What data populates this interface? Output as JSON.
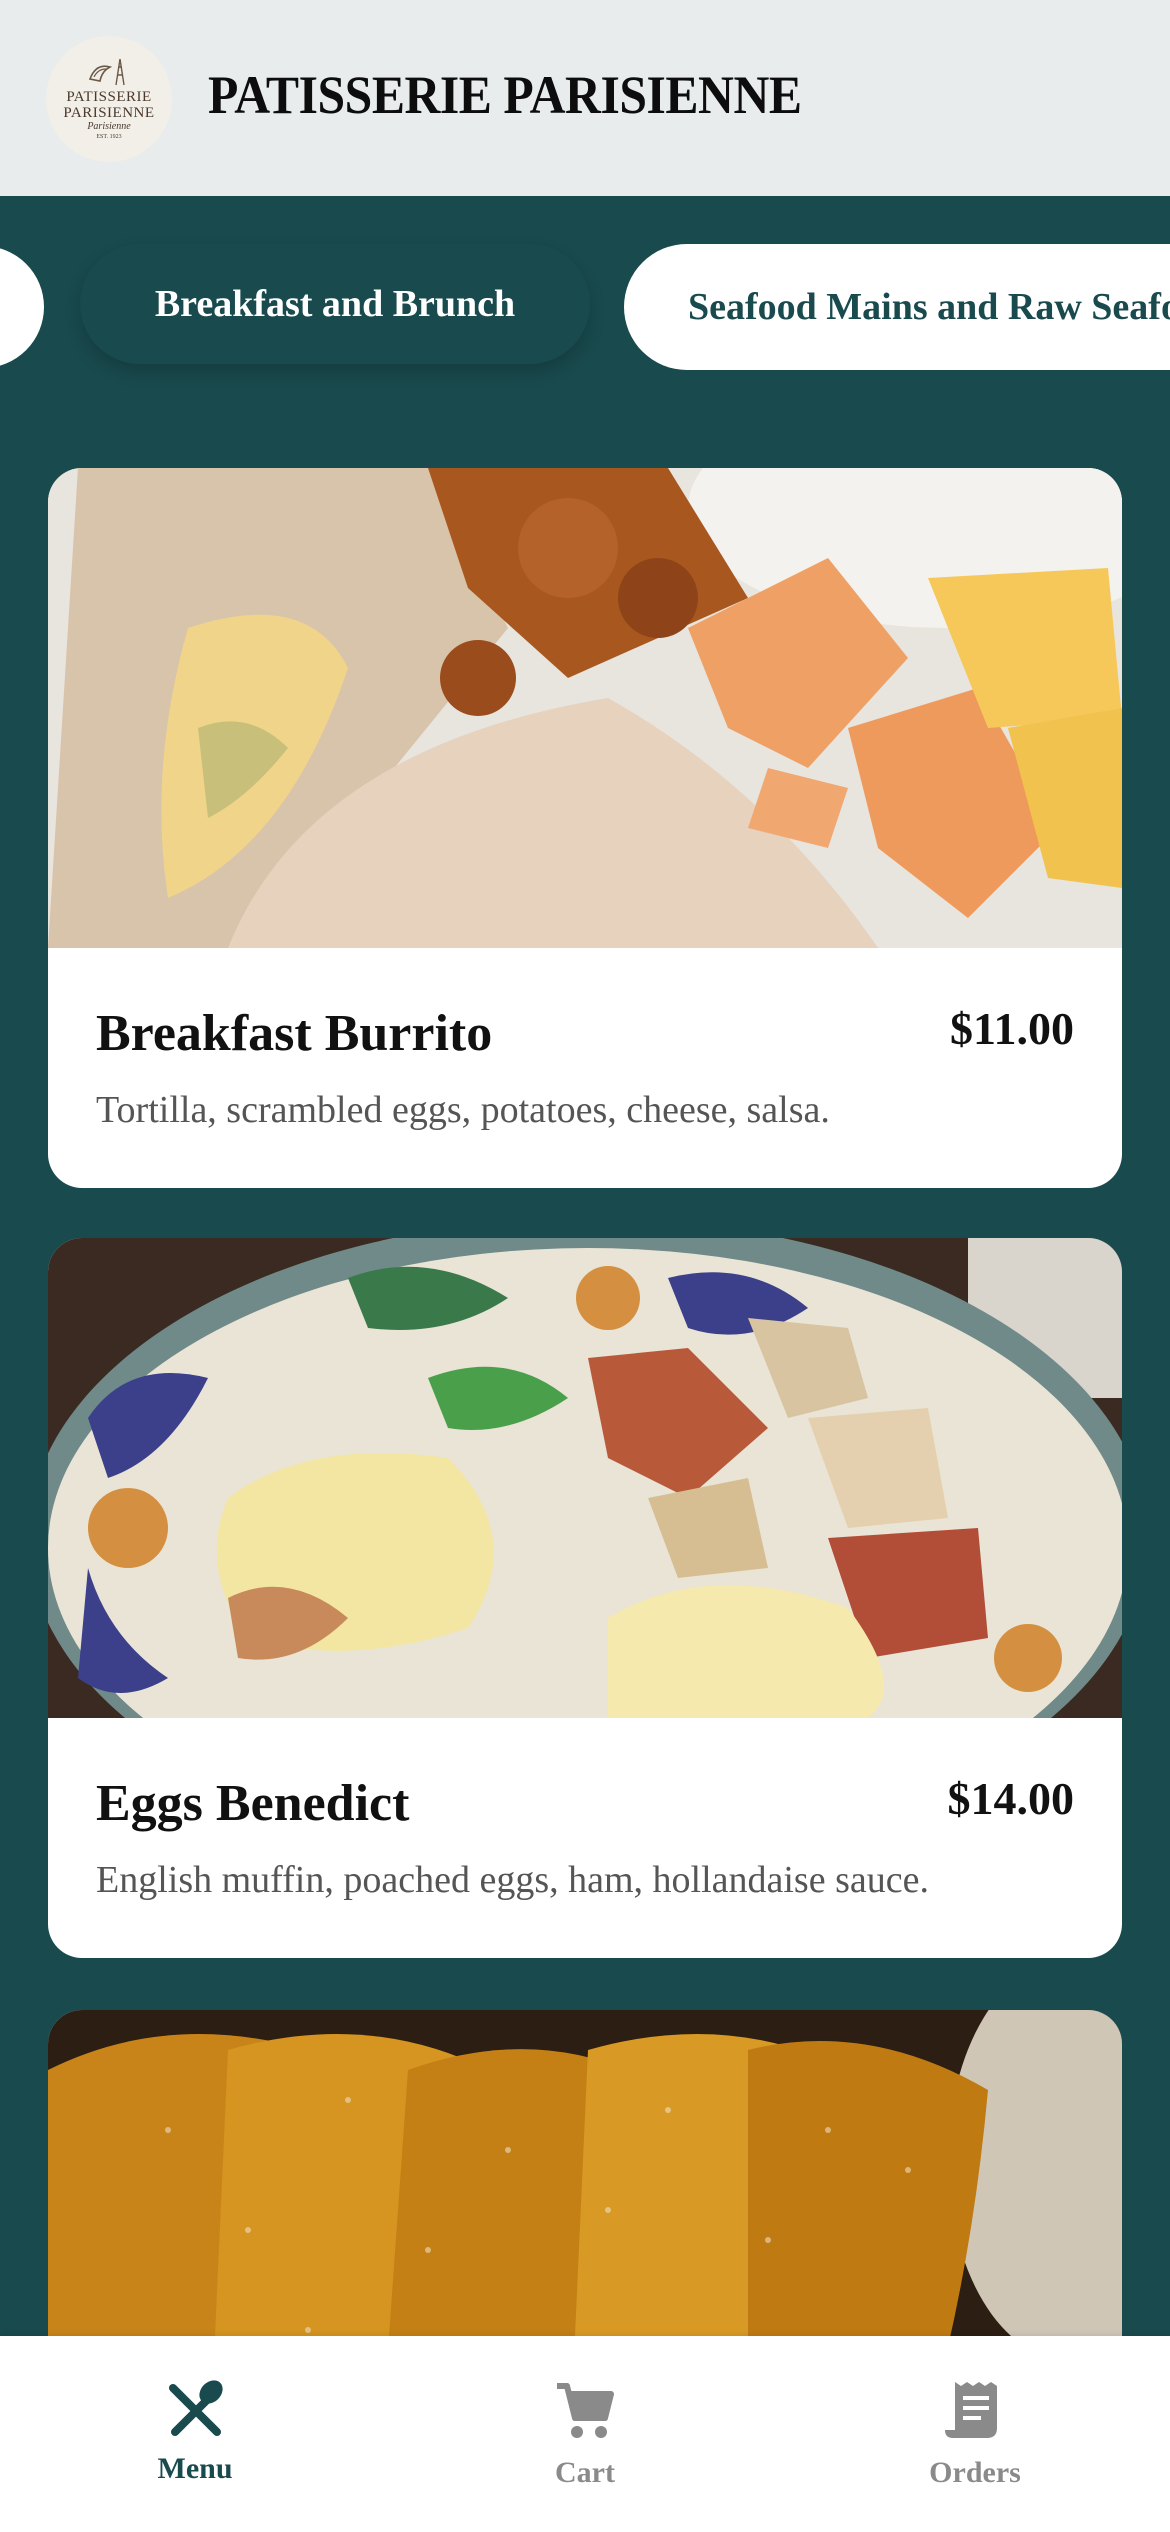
{
  "header": {
    "title": "PATISSERIE PARISIENNE",
    "logo": {
      "line1": "PATISSERIE",
      "line2": "PARISIENNE",
      "line3": "Parisienne",
      "line4": "EST. 1923"
    }
  },
  "tabs": [
    {
      "label": "Breakfast and Brunch",
      "active": true
    },
    {
      "label": "Seafood Mains and Raw Seafood",
      "active": false
    }
  ],
  "menu_items": [
    {
      "name": "Breakfast Burrito",
      "price": "$11.00",
      "description": "Tortilla, scrambled eggs, potatoes, cheese, salsa."
    },
    {
      "name": "Eggs Benedict",
      "price": "$14.00",
      "description": "English muffin, poached eggs, ham, hollandaise sauce."
    },
    {
      "name": "",
      "price": "",
      "description": ""
    }
  ],
  "bottom_nav": [
    {
      "label": "Menu",
      "icon": "fork-knife-icon",
      "active": true
    },
    {
      "label": "Cart",
      "icon": "cart-icon",
      "active": false
    },
    {
      "label": "Orders",
      "icon": "receipt-icon",
      "active": false
    }
  ],
  "colors": {
    "brand": "#194a4e",
    "header_bg": "#e8ecec",
    "inactive": "#8a8a8a"
  }
}
